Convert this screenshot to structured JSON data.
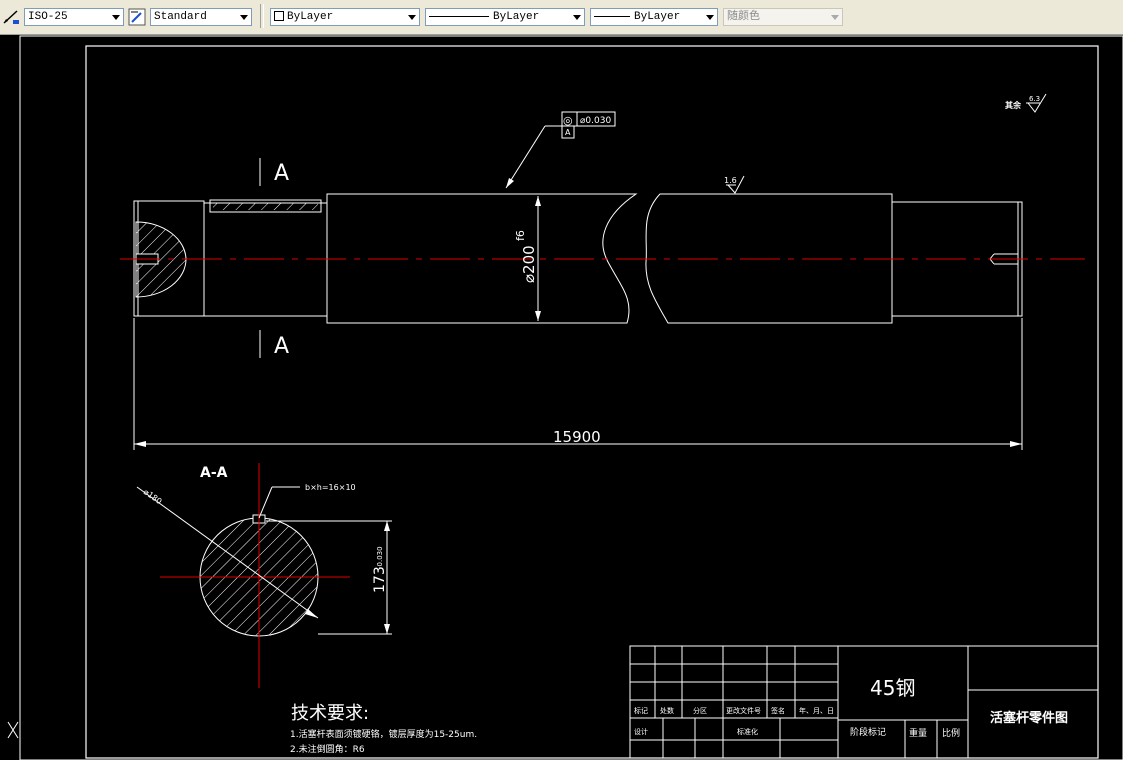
{
  "toolbar": {
    "dim_style": "ISO-25",
    "text_style": "Standard",
    "layer": "ByLayer",
    "linetype": "ByLayer",
    "lineweight": "ByLayer",
    "color": "随颜色"
  },
  "drawing": {
    "section_mark_top": "A",
    "section_mark_bottom": "A",
    "diameter_label": "⌀200",
    "diameter_tol": "f6",
    "gtol_symbol": "◎",
    "gtol_value": "⌀0.030",
    "gtol_datum": "A",
    "surface_rest_label": "其余",
    "surface_rest_value": "6.3",
    "surface_top_value": "1.6",
    "overall_length": "15900",
    "section_title": "A-A",
    "section_diameter": "⌀180",
    "keyway_label": "b×h=16×10",
    "keyway_depth": "173",
    "keyway_depth_tol": "-0.030"
  },
  "tech_requirements": {
    "title": "技术要求:",
    "items": [
      "1.活塞杆表面须镀硬铬，镀层厚度为15-25um.",
      "2.未注倒圆角：R6"
    ]
  },
  "title_block": {
    "material": "45钢",
    "drawing_name": "活塞杆零件图",
    "row_labels": [
      "标记",
      "处数",
      "分区",
      "更改文件号",
      "签名",
      "年、月、日"
    ],
    "design_label": "设计",
    "standard_label": "标准化",
    "stage_label": "阶段标记",
    "weight_label": "重量",
    "scale_label": "比例"
  }
}
